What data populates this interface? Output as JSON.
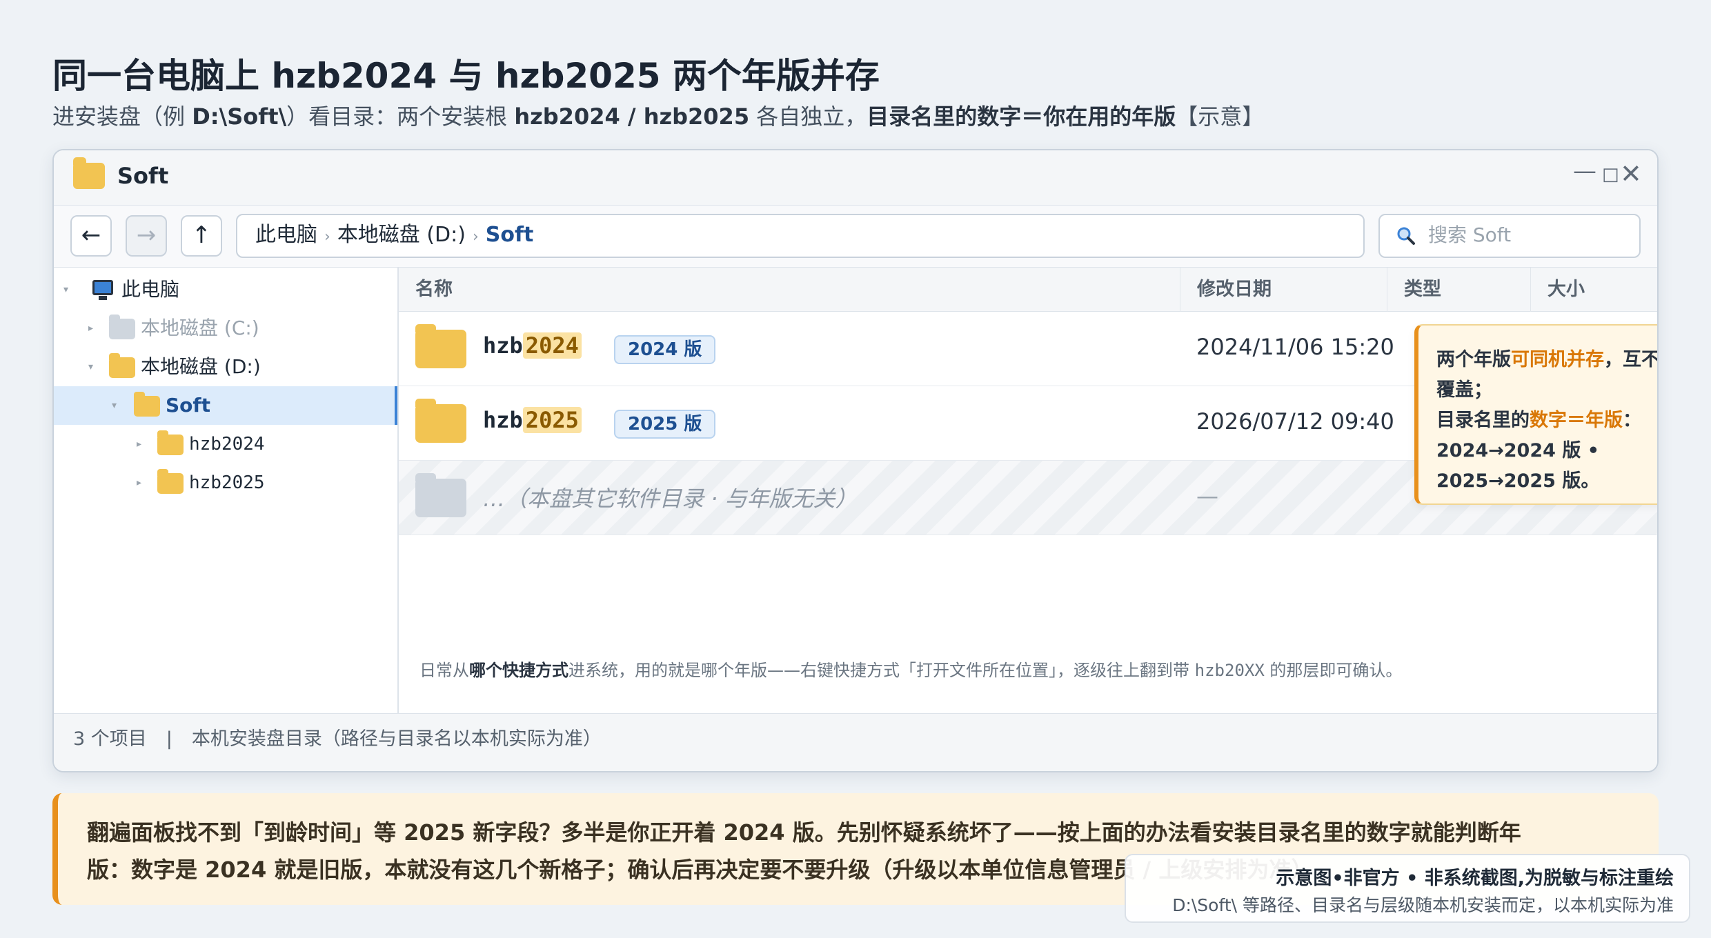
{
  "header": {
    "title": "同一台电脑上 hzb2024 与 hzb2025 两个年版并存",
    "subtitle_plain": "进安装盘（例 ",
    "subtitle_path": "D:\\Soft\\",
    "subtitle_mid": "）看目录：两个安装根 ",
    "subtitle_dirs": "hzb2024 / hzb2025",
    "subtitle_after": " 各自独立，",
    "subtitle_bold": "目录名里的数字＝你在用的年版",
    "subtitle_tail": "【示意】"
  },
  "window": {
    "title": "Soft",
    "controls": {
      "minimize": "—",
      "maximize": "□",
      "close": "✕"
    }
  },
  "toolbar": {
    "back": "←",
    "forward": "→",
    "up": "↑",
    "breadcrumb": [
      "此电脑",
      "本地磁盘 (D:)",
      "Soft"
    ],
    "breadcrumb_sep": "›",
    "search_placeholder": "搜索 Soft"
  },
  "sidebar": {
    "items": [
      {
        "label": "此电脑"
      },
      {
        "label": "本地磁盘 (C:)"
      },
      {
        "label": "本地磁盘 (D:)"
      },
      {
        "label": "Soft"
      },
      {
        "label": "hzb2024"
      },
      {
        "label": "hzb2025"
      }
    ]
  },
  "columns": {
    "name": "名称",
    "date": "修改日期",
    "type": "类型",
    "size": "大小"
  },
  "rows": [
    {
      "prefix": "hzb",
      "year": "2024",
      "badge": "2024 版",
      "date": "2024/11/06 15:20"
    },
    {
      "prefix": "hzb",
      "year": "2025",
      "badge": "2025 版",
      "date": "2026/07/12 09:40"
    },
    {
      "name": "…（本盘其它软件目录 · 与年版无关）",
      "date": "—"
    }
  ],
  "callout": {
    "l1a": "两个年版",
    "l1b": "可同机并存",
    "l1c": "，互不覆盖；",
    "l2a": "目录名里的",
    "l2b": "数字＝年版",
    "l2c": "：",
    "l3": "2024→2024 版 •",
    "l4": "2025→2025 版。"
  },
  "footnote": {
    "a": "日常从",
    "b": "哪个快捷方式",
    "c": "进系统，用的就是哪个年版——右键快捷方式「打开文件所在位置」，逐级往上翻到带 ",
    "code": "hzb20XX",
    "d": " 的那层即可确认。"
  },
  "statusbar": {
    "count": "3 个项目",
    "divider": "|",
    "note": "本机安装盘目录（路径与目录名以本机实际为准）"
  },
  "banner": {
    "line1": "翻遍面板找不到「到龄时间」等 2025 新字段？多半是你正开着 2024 版。先别怀疑系统坏了——按上面的办法看安装目录名里的数字就能判断年",
    "line2": "版：数字是 2024 就是旧版，本就没有这几个新格子；确认后再决定要不要升级（升级以本单位信息管理员 / 上级安排为准）。"
  },
  "watermark": {
    "line1": "示意图•非官方 • 非系统截图,为脱敏与标注重绘",
    "line2": "D:\\Soft\\ 等路径、目录名与层级随本机安装而定，以本机实际为准"
  },
  "colors": {
    "accent": "#e8901c",
    "folder": "#f2c452",
    "link": "#1d4f91",
    "selection": "#dcebfb"
  }
}
